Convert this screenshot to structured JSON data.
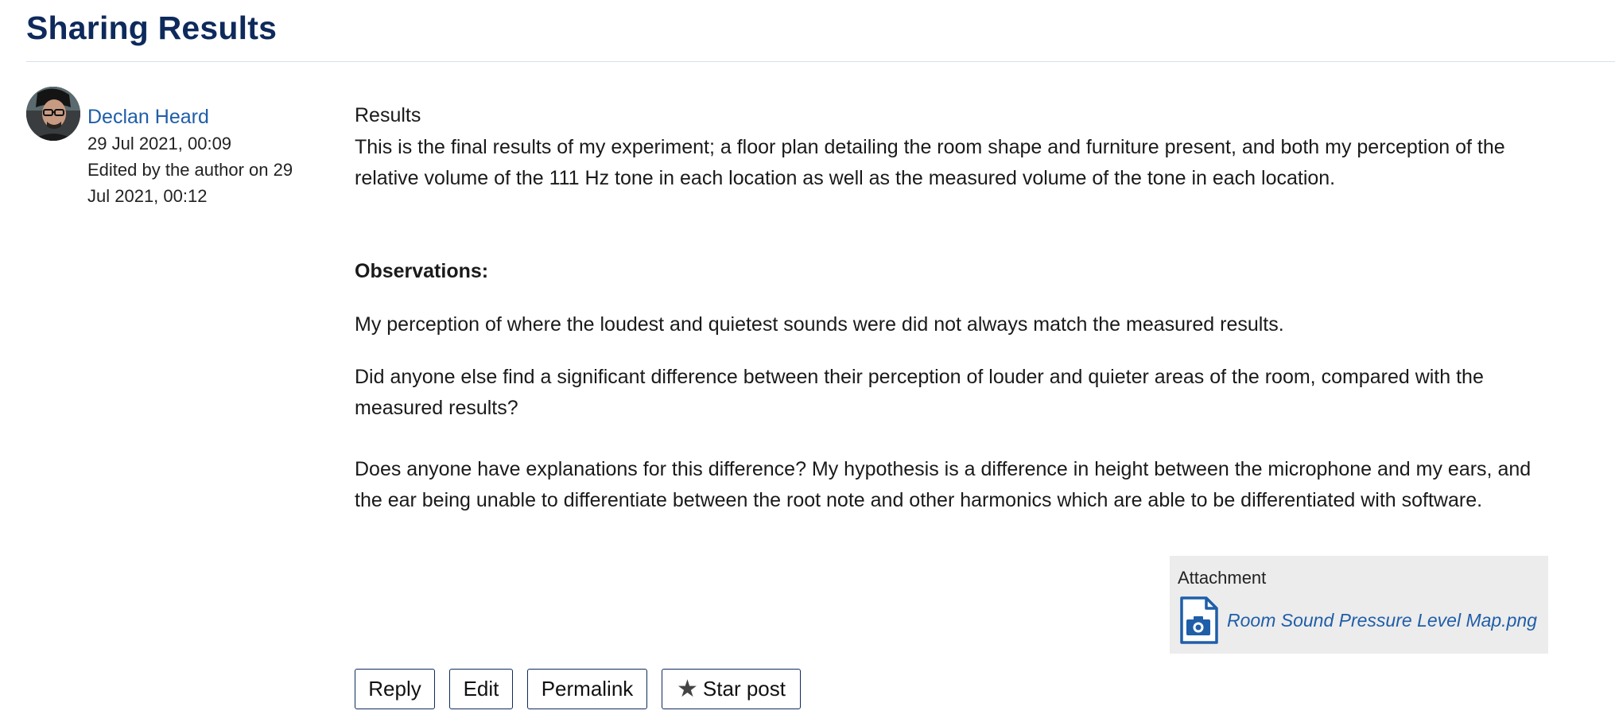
{
  "page": {
    "title": "Sharing Results"
  },
  "post": {
    "author": {
      "name": "Declan Heard",
      "date": "29 Jul 2021, 00:09",
      "edited_line1": "Edited by the author on 29",
      "edited_line2": "Jul 2021, 00:12"
    },
    "subject": "Results",
    "paragraphs": [
      "This is the final results of my experiment; a floor plan detailing the room shape and furniture present, and both my perception of the relative volume of the 111 Hz tone in each location as well as the measured volume of the tone in each location.",
      "Observations:",
      "My perception of where the loudest and quietest sounds were did not always match the measured results.",
      "Did anyone else find a significant difference between their perception of louder and quieter areas of the room, compared with the measured results?",
      "Does anyone have explanations for this difference? My hypothesis is a difference in height between the microphone and my ears, and the ear being unable to differentiate between the root note and other harmonics which are able to be differentiated with software."
    ],
    "attachment": {
      "label": "Attachment",
      "filename": "Room Sound Pressure Level Map.png",
      "icon": "image-file-icon"
    },
    "actions": {
      "reply": "Reply",
      "edit": "Edit",
      "permalink": "Permalink",
      "star": "Star post"
    }
  },
  "colors": {
    "title": "#0e2a5c",
    "link": "#1f5ea8",
    "button_border": "#0e2a5c",
    "attachment_bg": "#ececec"
  }
}
